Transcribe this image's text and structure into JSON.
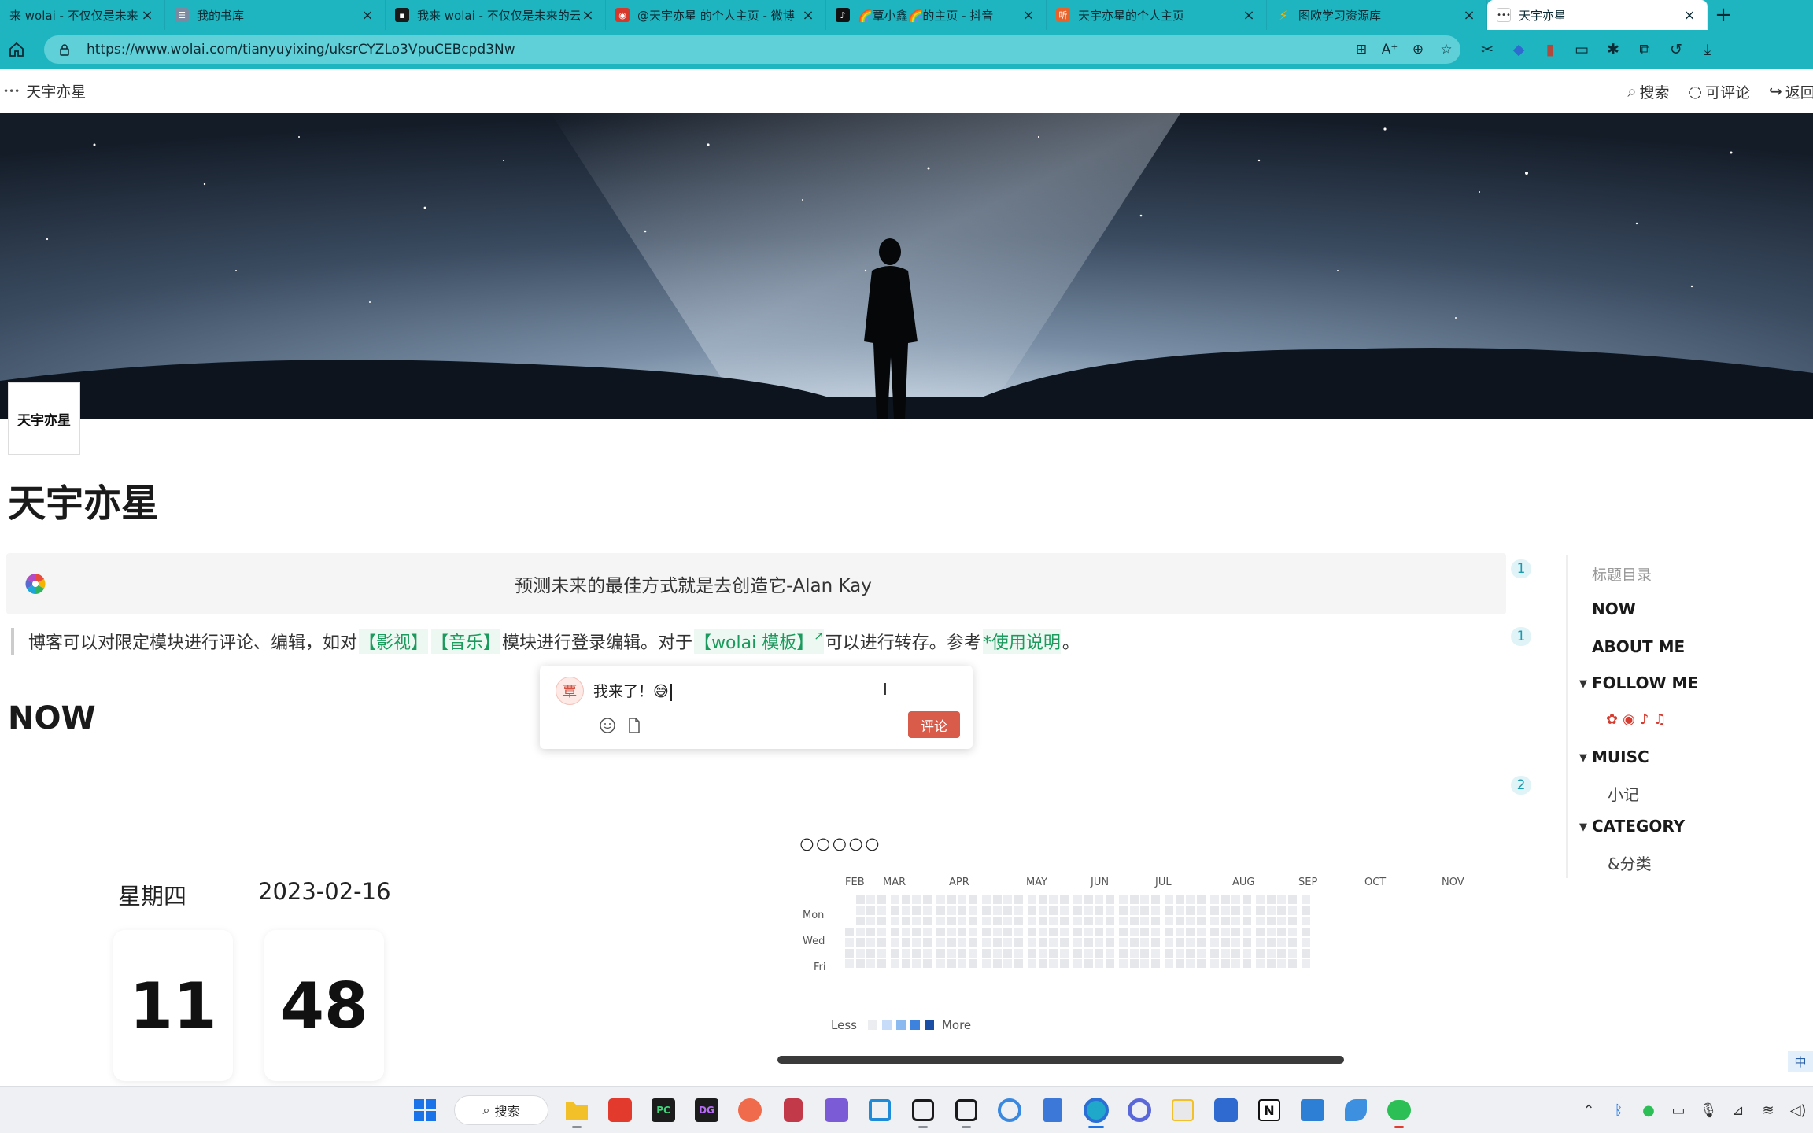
{
  "browser": {
    "tabs": [
      {
        "title": "来 wolai - 不仅仅是未来的云",
        "icon": "wolai-icon",
        "color": "#1a1a1a"
      },
      {
        "title": "我的书库",
        "icon": "library-icon",
        "color": "#7a8aa0"
      },
      {
        "title": "我来 wolai - 不仅仅是未来的云",
        "icon": "wolai-icon",
        "color": "#1a1a1a"
      },
      {
        "title": "@天宇亦星 的个人主页 - 微博",
        "icon": "weibo-icon",
        "color": "#d6382b"
      },
      {
        "title": "🌈覃小鑫🌈的主页 - 抖音",
        "icon": "tiktok-icon",
        "color": "#111111"
      },
      {
        "title": "天宇亦星的个人主页",
        "icon": "podcast-icon",
        "color": "#e8632b"
      },
      {
        "title": "图欧学习资源库",
        "icon": "lightning-icon",
        "color": "#f2b400"
      },
      {
        "title": "天宇亦星",
        "icon": "wolai-icon",
        "color": "#1a1a1a"
      }
    ],
    "url": "https://www.wolai.com/tianyuyixing/uksrCYZLo3VpuCEBcpd3Nw",
    "ai_label": "A⁺"
  },
  "page_header": {
    "breadcrumb": "天宇亦星",
    "breadcrumb_prefix": "•••",
    "search_label": "搜索",
    "comment_label": "可评论",
    "back_label": "返回"
  },
  "page": {
    "logo_text": "天宇亦星",
    "title": "天宇亦星",
    "quote": "预测未来的最佳方式就是去创造它-Alan Kay",
    "quote_badge": "1",
    "info_badge": "1",
    "section_badge": "2",
    "info": {
      "part1": "博客可以对限定模块进行评论、编辑，如对",
      "link1": "【影视】",
      "link2": "【音乐】",
      "part2": "模块进行登录编辑。对于",
      "link3": "【wolai 模板】",
      "ext_arrow": "↗",
      "part3": "可以进行转存。参考",
      "link4": "*使用说明",
      "part4": "。"
    },
    "now_heading": "NOW"
  },
  "comment_popup": {
    "avatar": "覃",
    "text": "我来了！😅",
    "submit_label": "评论"
  },
  "toc": {
    "heading": "标题目录",
    "items": [
      "NOW",
      "ABOUT ME",
      "FOLLOW ME",
      "MUISC",
      "CATEGORY"
    ],
    "sub_music": "小记",
    "sub_category": "&分类"
  },
  "clock": {
    "weekday": "星期四",
    "date": "2023-02-16",
    "hour": "11",
    "minute": "48"
  },
  "heatmap": {
    "faces": "🌕🌕🌕🌕🌕",
    "months": [
      "FEB",
      "MAR",
      "APR",
      "MAY",
      "JUN",
      "JUL",
      "AUG",
      "SEP",
      "OCT",
      "NOV"
    ],
    "weekdays": [
      "Mon",
      "Wed",
      "Fri"
    ],
    "legend_less": "Less",
    "legend_more": "More",
    "legend_colors": [
      "#ebedf0",
      "#c6dcf8",
      "#8bbaf0",
      "#3d83dd",
      "#1b4fa6"
    ]
  },
  "tray": {
    "ime": "中"
  },
  "taskbar": {
    "search_label": "搜索"
  }
}
